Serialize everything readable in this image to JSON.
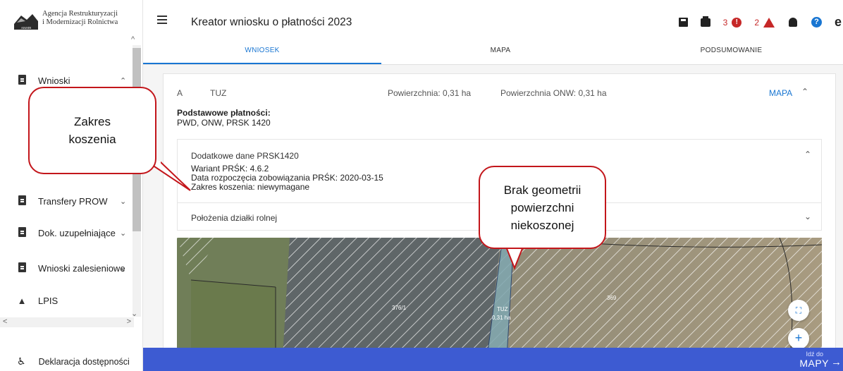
{
  "sidebar": {
    "logo_line1": "Agencja Restrukturyzacji",
    "logo_line2": "i Modernizacji Rolnictwa",
    "logo_mark_text": "ARiMR",
    "items": [
      {
        "label": "Wnioski",
        "icon": "clipboard-icon"
      },
      {
        "label": "Transfery PROW",
        "icon": "clipboard-icon"
      },
      {
        "label": "Dok. uzupełniające",
        "icon": "clipboard-icon"
      },
      {
        "label": "Wnioski zalesieniowe",
        "icon": "clipboard-icon"
      },
      {
        "label": "LPIS",
        "icon": "mountain-icon"
      }
    ],
    "accessibility_label": "Deklaracja dostępności"
  },
  "header": {
    "title": "Kreator wniosku o płatności 2023",
    "error_count": "3",
    "warning_count": "2"
  },
  "tabs": [
    {
      "label": "WNIOSEK",
      "active": true
    },
    {
      "label": "MAPA",
      "active": false
    },
    {
      "label": "PODSUMOWANIE",
      "active": false
    }
  ],
  "parcel": {
    "letter": "A",
    "type": "TUZ",
    "area": "Powierzchnia: 0,31 ha",
    "onw_area": "Powierzchnia ONW: 0,31 ha",
    "map_link": "MAPA",
    "basic_payments_label": "Podstawowe płatności:",
    "basic_payments_value": "PWD, ONW, PRSK 1420",
    "extra_title": "Dodatkowe dane PRSK1420",
    "variant": "Wariant PRŚK: 4.6.2",
    "start_date": "Data rozpoczęcia zobowiązania PRŚK: 2020-03-15",
    "mowing_range": "Zakres koszenia: niewymagane",
    "location_title": "Położenia działki rolnej"
  },
  "map": {
    "label_376": "376/1",
    "label_369": "369",
    "label_tuz": "TUZ",
    "label_area": "0,31 ha"
  },
  "footer": {
    "go_to_label": "Idź do",
    "go_to_value": "MAPY"
  },
  "callouts": {
    "mowing": [
      "Zakres",
      "koszenia"
    ],
    "geometry": [
      "Brak geometrii",
      "powierzchni",
      "niekoszonej"
    ]
  },
  "colors": {
    "accent": "#1976d2",
    "footer": "#3d5bd2",
    "error": "#c62828",
    "callout_border": "#c3161b"
  }
}
